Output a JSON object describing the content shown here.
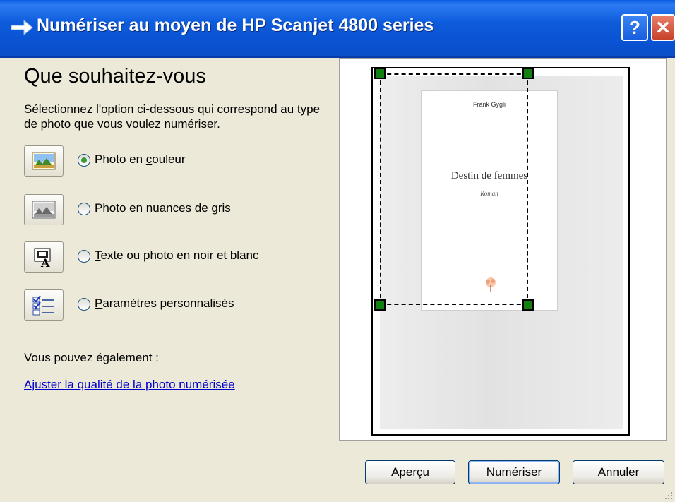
{
  "window": {
    "title": "Numériser au moyen de HP Scanjet 4800 series",
    "help_glyph": "?",
    "close_glyph": "✕"
  },
  "heading": "Que souhaitez-vous",
  "instructions": "Sélectionnez l'option ci-dessous qui correspond au type de photo que vous voulez numériser.",
  "options": [
    {
      "icon": "color-photo-icon",
      "before": "Photo en ",
      "mnemonic": "c",
      "after": "ouleur",
      "selected": true
    },
    {
      "icon": "grayscale-photo-icon",
      "before": "",
      "mnemonic": "P",
      "after": "hoto en nuances de gris",
      "selected": false
    },
    {
      "icon": "text-bw-icon",
      "before": "",
      "mnemonic": "T",
      "after": "exte ou photo en noir et blanc",
      "selected": false
    },
    {
      "icon": "custom-settings-icon",
      "before": "",
      "mnemonic": "P",
      "after": "aramètres personnalisés",
      "selected": false
    }
  ],
  "also_label": "Vous pouvez également :",
  "quality_link": "Ajuster la qualité de la photo numérisée",
  "preview": {
    "book_author": "Frank Gygli",
    "book_title": "Destin de femmes",
    "book_subtitle": "Roman"
  },
  "buttons": {
    "preview": {
      "mnemonic": "A",
      "rest": "perçu"
    },
    "scan": {
      "mnemonic": "N",
      "rest": "umériser"
    },
    "cancel": "Annuler"
  },
  "colors": {
    "titlebar": "#0A5CE2",
    "dialog_bg": "#ECE9D8",
    "link": "#0000CC",
    "handle": "#118011"
  }
}
